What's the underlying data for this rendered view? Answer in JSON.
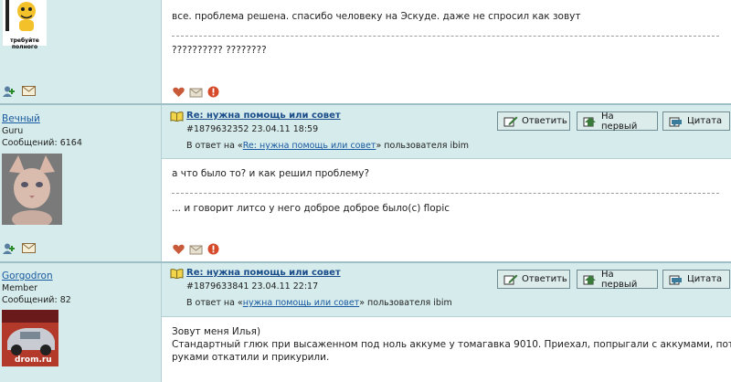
{
  "post1": {
    "avatar_caption": "требуйте полного",
    "body_text": "все. проблема решена. спасибо человеку на Эскуде. даже не спросил как зовут",
    "signature": "?????????? ????????"
  },
  "post2": {
    "username": "Вечный",
    "rank": "Guru",
    "messages": "Сообщений: 6164",
    "title": "Re: нужна помощь или совет",
    "meta": "#1879632352 23.04.11 18:59",
    "reply_prefix": "В ответ на «",
    "reply_link": "Re: нужна помощь или совет",
    "reply_suffix": "» пользователя ibim",
    "body_text": "а что было то? и как решил проблему?",
    "signature": "... и говорит литсо у него доброе доброе было(с) flopic"
  },
  "post3": {
    "username": "Gorgodron",
    "rank": "Member",
    "messages": "Сообщений: 82",
    "title": "Re: нужна помощь или совет",
    "meta": "#1879633841 23.04.11 22:17",
    "reply_prefix": "В ответ на «",
    "reply_link": "нужна помощь или совет",
    "reply_suffix": "» пользователя ibim",
    "body_line1": "Зовут меня Илья)",
    "body_line2": "Стандартный глюк при высаженном под ноль аккуме у томагавка 9010. Приехал, попрыгали с аккумами, потом",
    "body_line3": "руками откатили и прикурили.",
    "avatar_caption": "drom.ru"
  },
  "buttons": {
    "reply": "Ответить",
    "to_top": "На первый",
    "quote": "Цитата"
  },
  "colors": {
    "panel_bg": "#d6ebeb",
    "link": "#1a5aa0",
    "border": "#708b92"
  },
  "icons": [
    "heart-icon",
    "envelope-icon",
    "warning-icon",
    "add-friend-icon",
    "mail-icon",
    "book-icon",
    "pencil-icon",
    "arrow-up-icon",
    "quote-icon"
  ]
}
